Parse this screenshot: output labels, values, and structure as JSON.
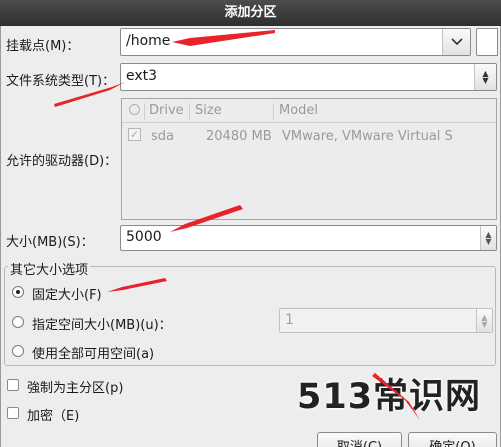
{
  "window": {
    "title": "添加分区"
  },
  "mount_point": {
    "label": "挂载点(M)：",
    "value": "/home"
  },
  "fs_type": {
    "label": "文件系统类型(T)：",
    "value": "ext3"
  },
  "drives": {
    "label": "允许的驱动器(D)：",
    "columns": [
      "Drive",
      "Size",
      "Model"
    ],
    "rows": [
      {
        "drive": "sda",
        "size": "20480 MB",
        "model": "VMware, VMware Virtual S",
        "checked": true
      }
    ]
  },
  "size": {
    "label": "大小(MB)(S)：",
    "value": "5000"
  },
  "other_options": {
    "legend": "其它大小选项",
    "fixed": "固定大小(F)",
    "fill_up_to": "指定空间大小(MB)(u)：",
    "fill_up_to_value": "1",
    "fill_all": "使用全部可用空间(a)",
    "selected": "fixed"
  },
  "primary": {
    "label": "強制为主分区(p)",
    "checked": false
  },
  "encrypt": {
    "label": "加密（E)",
    "checked": false
  },
  "buttons": {
    "cancel": "取消(C)",
    "ok": "确定(O)"
  },
  "watermark": "513常识网",
  "colors": {
    "annotation_arrow": "#e8232a",
    "titlebar": "#3a3a3a"
  }
}
